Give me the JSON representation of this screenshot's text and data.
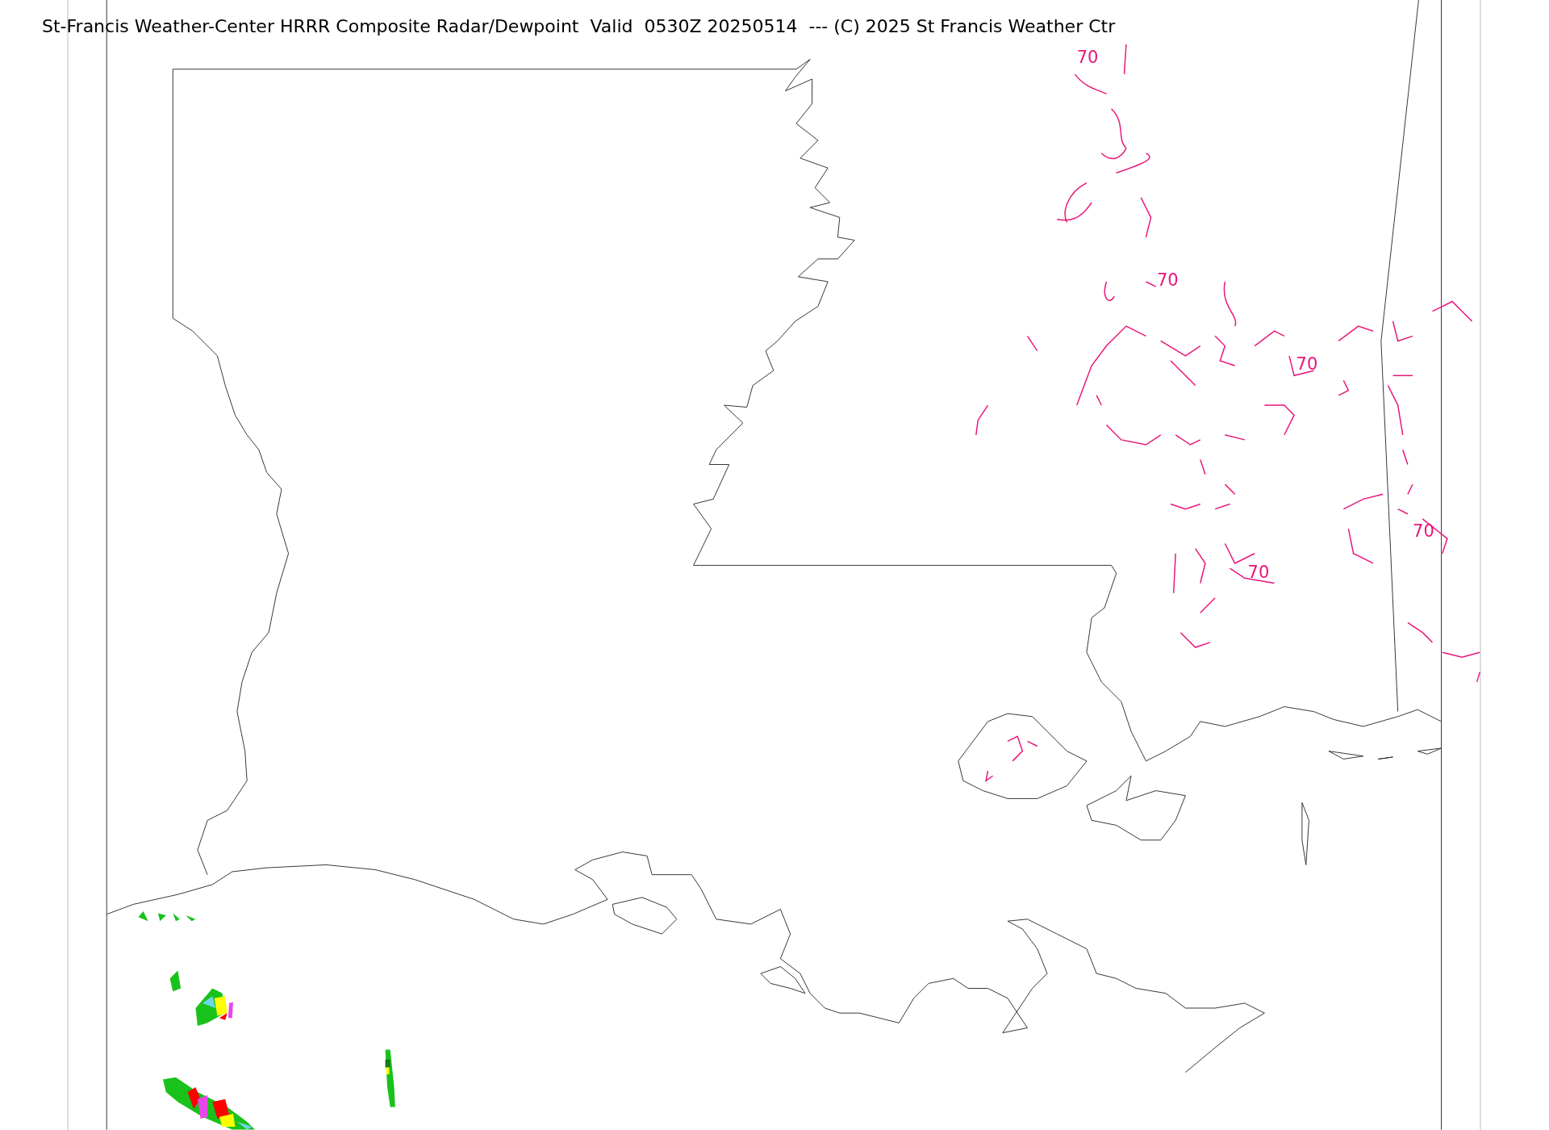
{
  "title": "St-Francis Weather-Center HRRR Composite Radar/Dewpoint  Valid  0530Z 20250514  --- (C) 2025 St Francis Weather Ctr",
  "contour_labels": [
    {
      "label": "70"
    },
    {
      "label": "70"
    },
    {
      "label": "70"
    },
    {
      "label": "70"
    },
    {
      "label": "70"
    }
  ]
}
